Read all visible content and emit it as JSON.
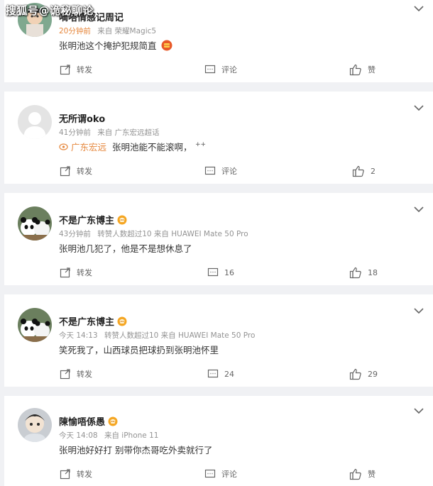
{
  "watermark": "搜狐号@诡秘聊论",
  "comments": [
    {
      "name": "嘀嗒情感记周记",
      "badge": false,
      "time": "20分钟前",
      "source": "来自 荣耀Magic5",
      "location_tag": "",
      "text": "张明池这个掩护犯规简直",
      "emoji": "red-envelope-icon",
      "share_label": "转发",
      "comment_label": "评论",
      "like_label": "赞"
    },
    {
      "name": "无所谓oko",
      "badge": false,
      "time": "41分钟前",
      "source": "来自 广东宏远超话",
      "location_tag": "广东宏远",
      "text": "张明池能不能滚啊，",
      "share_label": "转发",
      "comment_label": "评论",
      "like_label": "2"
    },
    {
      "name": "不是广东博主",
      "badge": true,
      "time": "43分钟前",
      "source": "转赞人数超过10 来自 HUAWEI Mate 50 Pro",
      "location_tag": "",
      "text": "张明池几犯了，他是不是想休息了",
      "share_label": "转发",
      "comment_label": "16",
      "like_label": "18"
    },
    {
      "name": "不是广东博主",
      "badge": true,
      "time": "今天 14:13",
      "source": "转赞人数超过10 来自 HUAWEI Mate 50 Pro",
      "location_tag": "",
      "text": "笑死我了，山西球员把球扔到张明池怀里",
      "share_label": "转发",
      "comment_label": "24",
      "like_label": "29"
    },
    {
      "name": "陳愉唔係愚",
      "badge": true,
      "time": "今天 14:08",
      "source": "来自 iPhone 11",
      "location_tag": "",
      "text": "张明池好好打 别带你杰哥吃外卖就行了",
      "share_label": "转发",
      "comment_label": "评论",
      "like_label": "赞"
    }
  ],
  "colors": {
    "background": "#f0f1f4",
    "card": "#ffffff",
    "accent_orange": "#e6873c",
    "meta_gray": "#939393",
    "badge": "#f5a623"
  }
}
